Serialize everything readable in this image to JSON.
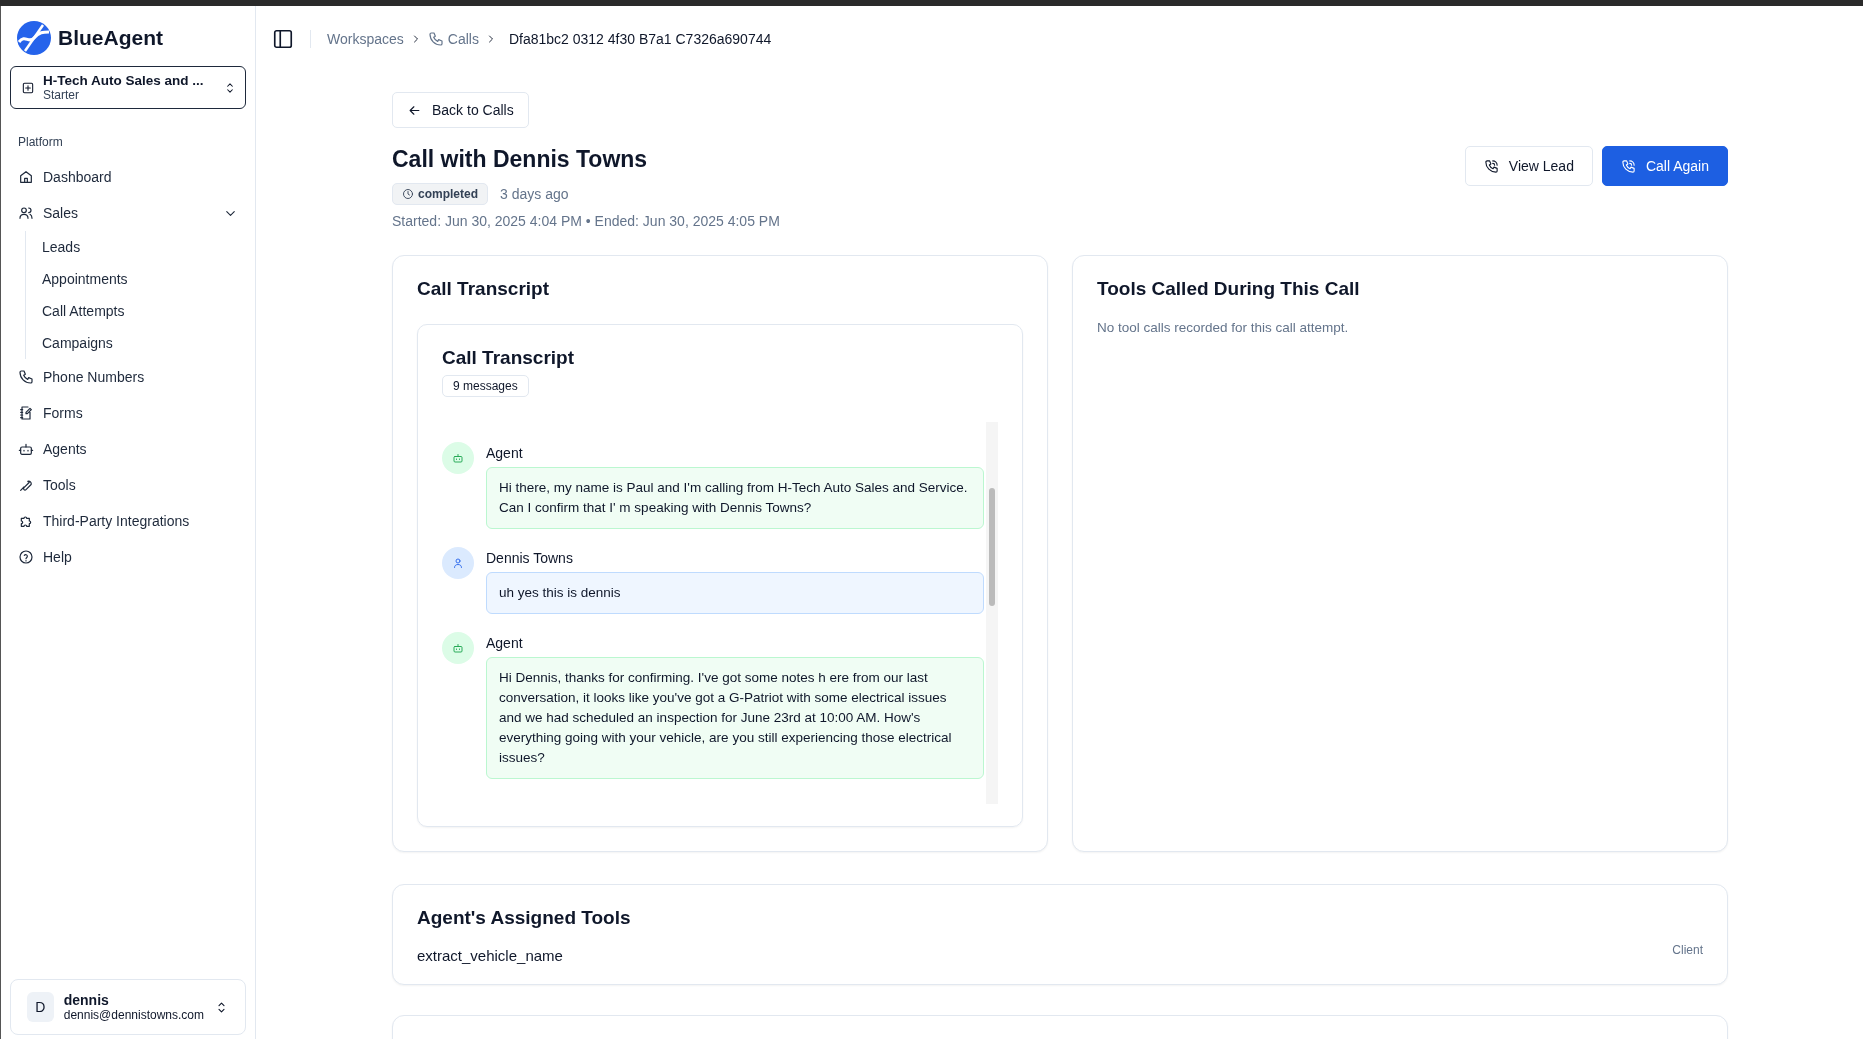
{
  "sidebar": {
    "brand": "BlueAgent",
    "workspace": {
      "name": "H-Tech Auto Sales and ...",
      "plan": "Starter"
    },
    "section_label": "Platform",
    "items": [
      {
        "label": "Dashboard"
      },
      {
        "label": "Sales",
        "expanded": true,
        "children": [
          {
            "label": "Leads"
          },
          {
            "label": "Appointments"
          },
          {
            "label": "Call Attempts"
          },
          {
            "label": "Campaigns"
          }
        ]
      },
      {
        "label": "Phone Numbers"
      },
      {
        "label": "Forms"
      },
      {
        "label": "Agents"
      },
      {
        "label": "Tools"
      },
      {
        "label": "Third-Party Integrations"
      },
      {
        "label": "Help"
      }
    ],
    "user": {
      "initial": "D",
      "name": "dennis",
      "email": "dennis@dennistowns.com"
    }
  },
  "breadcrumb": [
    {
      "label": "Workspaces",
      "current": false
    },
    {
      "label": "Calls",
      "current": false
    },
    {
      "label": "Dfa81bc2 0312 4f30 B7a1 C7326a690744",
      "current": true
    }
  ],
  "back_button": "Back to Calls",
  "title": "Call with Dennis Towns",
  "status": "completed",
  "age": "3 days ago",
  "times": "Started: Jun 30, 2025 4:04 PM • Ended: Jun 30, 2025 4:05 PM",
  "actions": [
    {
      "label": "View Lead",
      "primary": false
    },
    {
      "label": "Call Again",
      "primary": true
    }
  ],
  "transcript_card": {
    "title": "Call Transcript",
    "inner_title": "Call Transcript",
    "count": "9 messages",
    "messages": [
      {
        "kind": "agent",
        "speaker": "Agent",
        "text": "Hi there, my name is Paul and I'm calling from H-Tech Auto Sales and Service. Can I confirm that I' m speaking with Dennis Towns?"
      },
      {
        "kind": "user",
        "speaker": "Dennis Towns",
        "text": "uh yes this is dennis"
      },
      {
        "kind": "agent",
        "speaker": "Agent",
        "text": "Hi Dennis, thanks for confirming.  I've got some notes h ere from our last conversation, it looks like you've got a G-Patriot with some electrical issues and we had scheduled an inspection for June 23rd at 10:00 AM. How's everything going with your vehicle, are you still experiencing those electrical issues?"
      }
    ]
  },
  "tools_called": {
    "title": "Tools Called During This Call",
    "empty_text": "No tool calls recorded for this call attempt."
  },
  "assigned_tools": {
    "title": "Agent's Assigned Tools",
    "tools": [
      {
        "name": "extract_vehicle_name",
        "type": "Client"
      }
    ]
  }
}
